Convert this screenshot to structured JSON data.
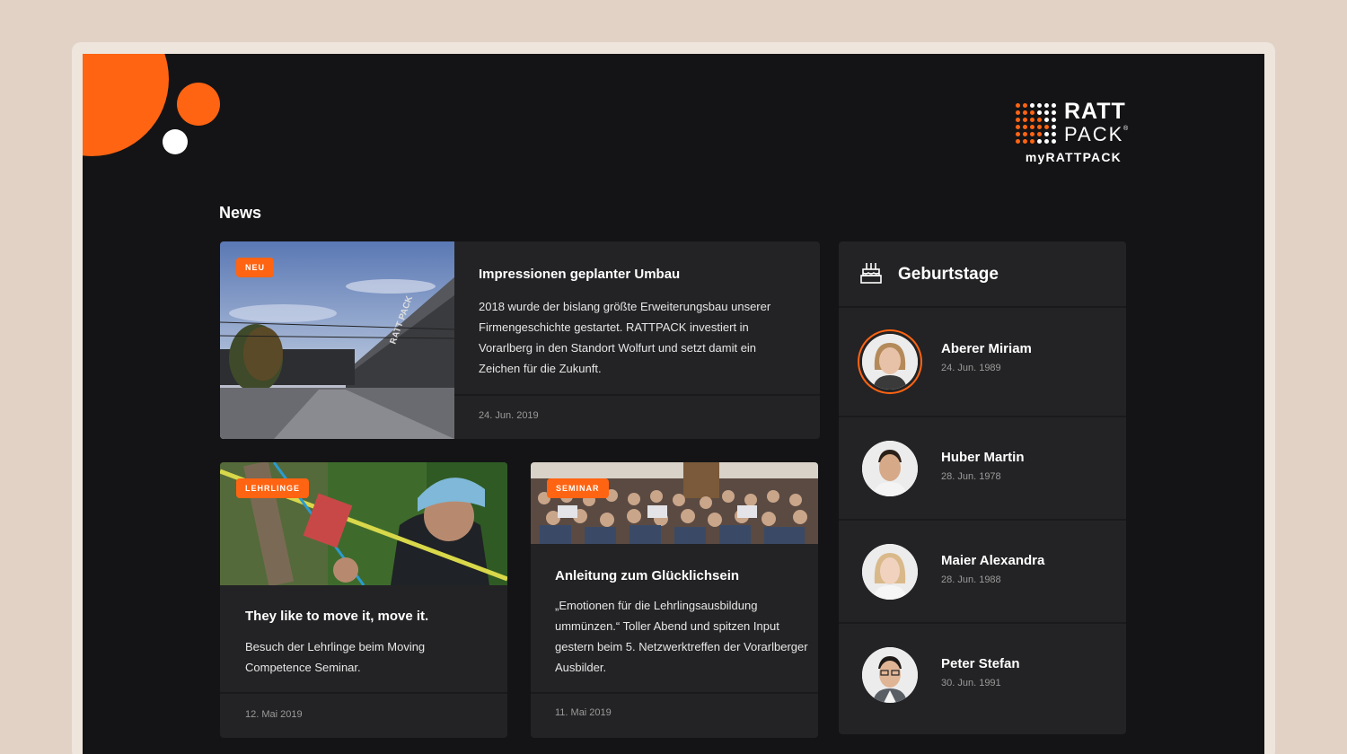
{
  "brand": {
    "logo_line1": "RATT",
    "logo_line2": "PACK",
    "logo_reg": "®",
    "logo_sub": "myRATTPACK",
    "accent": "#ff6412"
  },
  "news": {
    "heading": "News",
    "featured": {
      "badge": "NEU",
      "title": "Impressionen geplanter Umbau",
      "text": "2018 wurde der bislang größte Erweiterungsbau unserer Firmengeschichte gestartet. RATTPACK investiert in Vorarlberg in den Standort Wolfurt und setzt damit ein Zeichen für die Zukunft.",
      "date": "24. Jun. 2019",
      "building_sign": "RATT PACK"
    },
    "items": [
      {
        "badge": "LEHRLINGE",
        "title": "They like to move it, move it.",
        "text": "Besuch der Lehrlinge beim Moving Competence Seminar.",
        "date": "12. Mai 2019"
      },
      {
        "badge": "SEMINAR",
        "title": "Anleitung zum Glücklichsein",
        "text": "„Emotionen für die Lehrlingsausbildung ummünzen.“ Toller Abend und spitzen Input gestern beim 5. Netzwerktreffen der Vorarlberger Ausbilder.",
        "date": "11. Mai 2019"
      }
    ]
  },
  "birthdays": {
    "title": "Geburtstage",
    "icon": "cake-icon",
    "people": [
      {
        "name": "Aberer Miriam",
        "date": "24. Jun. 1989"
      },
      {
        "name": "Huber Martin",
        "date": "28. Jun. 1978"
      },
      {
        "name": "Maier Alexandra",
        "date": "28. Jun. 1988"
      },
      {
        "name": "Peter Stefan",
        "date": "30. Jun. 1991"
      }
    ]
  }
}
